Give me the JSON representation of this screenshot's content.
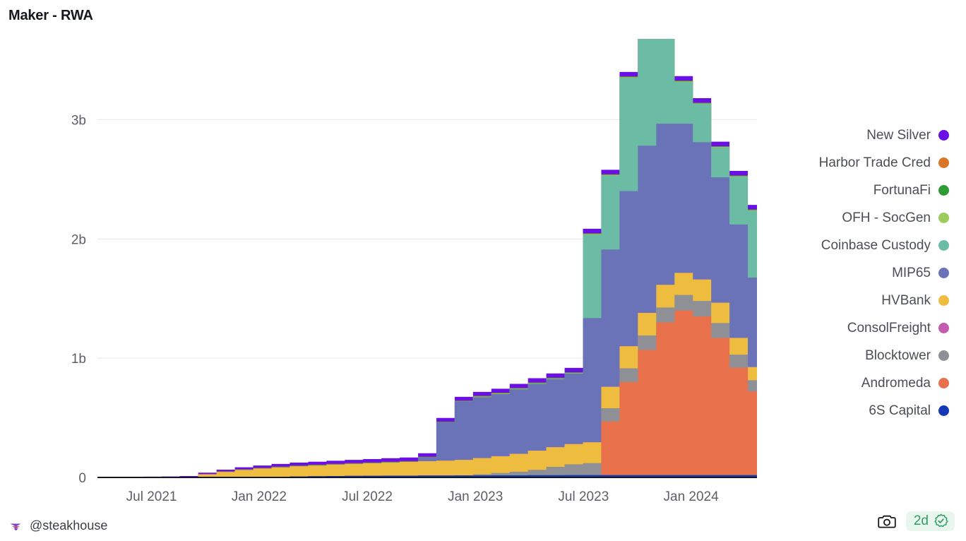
{
  "title": "Maker - RWA",
  "footer": {
    "handle": "@steakhouse",
    "logo_icon": "steakhouse-logo-icon",
    "camera_icon": "camera-icon",
    "freshness": "2d",
    "verified_icon": "verified-check-icon"
  },
  "legend": {
    "position": "right",
    "items": [
      {
        "label": "New Silver",
        "color": "#6a10e6"
      },
      {
        "label": "Harbor Trade Cred",
        "color": "#d97524"
      },
      {
        "label": "FortunaFi",
        "color": "#2e9b35"
      },
      {
        "label": "OFH - SocGen",
        "color": "#9ccb5e"
      },
      {
        "label": "Coinbase Custody",
        "color": "#6cbca5"
      },
      {
        "label": "MIP65",
        "color": "#6a72b8"
      },
      {
        "label": "HVBank",
        "color": "#eebc3f"
      },
      {
        "label": "ConsolFreight",
        "color": "#c45cb0"
      },
      {
        "label": "Blocktower",
        "color": "#8e9096"
      },
      {
        "label": "Andromeda",
        "color": "#e8714c"
      },
      {
        "label": "6S Capital",
        "color": "#1539b4"
      }
    ]
  },
  "chart_data": {
    "type": "area",
    "stacked": true,
    "title": "Maker - RWA",
    "xlabel": "",
    "ylabel": "",
    "grid": true,
    "ylim": [
      0,
      3500000000
    ],
    "yticks": [
      0,
      1000000000,
      2000000000,
      3000000000
    ],
    "ytick_labels": [
      "0",
      "1b",
      "2b",
      "3b"
    ],
    "xticks": [
      "Jul 2021",
      "Jan 2022",
      "Jul 2022",
      "Jan 2023",
      "Jul 2023",
      "Jan 2024"
    ],
    "xtick_positions": [
      0.082,
      0.245,
      0.409,
      0.573,
      0.737,
      0.9
    ],
    "x_range": [
      "2021-04",
      "2024-04"
    ],
    "x": [
      "2021-04",
      "2021-05",
      "2021-06",
      "2021-07",
      "2021-08",
      "2021-09",
      "2021-10",
      "2021-11",
      "2021-12",
      "2022-01",
      "2022-02",
      "2022-03",
      "2022-04",
      "2022-05",
      "2022-06",
      "2022-07",
      "2022-08",
      "2022-09",
      "2022-10",
      "2022-11",
      "2022-12",
      "2023-01",
      "2023-02",
      "2023-03",
      "2023-04",
      "2023-05",
      "2023-06",
      "2023-07",
      "2023-08",
      "2023-09",
      "2023-10",
      "2023-11",
      "2023-12",
      "2024-01",
      "2024-02",
      "2024-03",
      "2024-04"
    ],
    "series": [
      {
        "name": "6S Capital",
        "color": "#1539b4",
        "values": [
          0,
          0,
          0,
          0,
          0,
          0,
          0,
          1000000,
          2000000,
          4000000,
          6000000,
          8000000,
          10000000,
          12000000,
          13000000,
          14000000,
          15000000,
          15000000,
          16000000,
          16000000,
          17000000,
          17000000,
          18000000,
          18000000,
          19000000,
          19000000,
          20000000,
          20000000,
          20000000,
          20000000,
          20000000,
          20000000,
          20000000,
          20000000,
          20000000,
          20000000,
          20000000
        ]
      },
      {
        "name": "Andromeda",
        "color": "#e8714c",
        "values": [
          0,
          0,
          0,
          0,
          0,
          0,
          0,
          0,
          0,
          0,
          0,
          0,
          0,
          0,
          0,
          0,
          0,
          0,
          0,
          0,
          0,
          0,
          0,
          0,
          0,
          0,
          0,
          0,
          450000000,
          780000000,
          1050000000,
          1280000000,
          1380000000,
          1330000000,
          1150000000,
          900000000,
          700000000
        ]
      },
      {
        "name": "Blocktower",
        "color": "#8e9096",
        "values": [
          0,
          0,
          0,
          0,
          0,
          0,
          0,
          0,
          0,
          0,
          0,
          0,
          0,
          0,
          0,
          0,
          0,
          0,
          0,
          0,
          0,
          10000000,
          20000000,
          30000000,
          45000000,
          70000000,
          90000000,
          100000000,
          110000000,
          115000000,
          120000000,
          125000000,
          130000000,
          130000000,
          125000000,
          110000000,
          95000000
        ]
      },
      {
        "name": "HVBank",
        "color": "#eebc3f",
        "values": [
          0,
          0,
          0,
          0,
          0,
          2000000,
          25000000,
          45000000,
          60000000,
          70000000,
          78000000,
          85000000,
          90000000,
          95000000,
          100000000,
          105000000,
          110000000,
          115000000,
          120000000,
          125000000,
          130000000,
          135000000,
          140000000,
          150000000,
          160000000,
          165000000,
          170000000,
          175000000,
          180000000,
          185000000,
          190000000,
          190000000,
          185000000,
          180000000,
          170000000,
          140000000,
          110000000
        ]
      },
      {
        "name": "ConsolFreight",
        "color": "#c45cb0",
        "values": [
          1000000,
          1000000,
          1000000,
          1000000,
          1000000,
          1000000,
          1000000,
          1000000,
          1000000,
          1000000,
          1000000,
          1000000,
          1000000,
          1000000,
          1000000,
          1000000,
          1000000,
          1000000,
          1000000,
          1000000,
          1000000,
          1000000,
          1000000,
          1000000,
          1000000,
          1000000,
          1000000,
          1000000,
          1000000,
          1000000,
          1000000,
          1000000,
          1000000,
          1000000,
          1000000,
          1000000,
          1000000
        ]
      },
      {
        "name": "MIP65",
        "color": "#6a72b8",
        "values": [
          0,
          0,
          0,
          0,
          0,
          0,
          0,
          0,
          0,
          0,
          0,
          0,
          0,
          0,
          0,
          0,
          0,
          0,
          30000000,
          320000000,
          490000000,
          510000000,
          520000000,
          540000000,
          560000000,
          570000000,
          590000000,
          1040000000,
          1150000000,
          1300000000,
          1400000000,
          1350000000,
          1250000000,
          1150000000,
          1050000000,
          950000000,
          750000000
        ]
      },
      {
        "name": "Coinbase Custody",
        "color": "#6cbca5",
        "values": [
          0,
          0,
          0,
          0,
          0,
          0,
          0,
          0,
          0,
          0,
          0,
          0,
          0,
          0,
          0,
          0,
          0,
          0,
          0,
          0,
          0,
          0,
          0,
          0,
          0,
          0,
          0,
          700000000,
          620000000,
          950000000,
          1450000000,
          760000000,
          350000000,
          320000000,
          250000000,
          400000000,
          560000000
        ]
      },
      {
        "name": "OFH - SocGen",
        "color": "#9ccb5e",
        "values": [
          0,
          0,
          0,
          0,
          0,
          0,
          0,
          0,
          0,
          0,
          0,
          0,
          0,
          0,
          0,
          0,
          0,
          0,
          0,
          0,
          0,
          5000000,
          5000000,
          5000000,
          5000000,
          5000000,
          5000000,
          5000000,
          5000000,
          5000000,
          5000000,
          5000000,
          5000000,
          5000000,
          5000000,
          5000000,
          5000000
        ]
      },
      {
        "name": "FortunaFi",
        "color": "#2e9b35",
        "values": [
          0,
          0,
          0,
          0,
          0,
          0,
          1000000,
          2000000,
          3000000,
          3000000,
          4000000,
          4000000,
          4000000,
          4000000,
          4000000,
          4000000,
          4000000,
          4000000,
          4000000,
          4000000,
          4000000,
          4000000,
          4000000,
          4000000,
          4000000,
          4000000,
          4000000,
          4000000,
          4000000,
          4000000,
          4000000,
          4000000,
          4000000,
          4000000,
          4000000,
          4000000,
          4000000
        ]
      },
      {
        "name": "Harbor Trade Cred",
        "color": "#d97524",
        "values": [
          1000000,
          1000000,
          1000000,
          1000000,
          1000000,
          1000000,
          2000000,
          2000000,
          2000000,
          2000000,
          2000000,
          2000000,
          2000000,
          2000000,
          2000000,
          2000000,
          2000000,
          2000000,
          2000000,
          2000000,
          2000000,
          2000000,
          2000000,
          2000000,
          2000000,
          2000000,
          2000000,
          2000000,
          2000000,
          2000000,
          2000000,
          2000000,
          2000000,
          2000000,
          2000000,
          2000000,
          2000000
        ]
      },
      {
        "name": "New Silver",
        "color": "#6a10e6",
        "values": [
          2000000,
          3000000,
          4000000,
          5000000,
          6000000,
          8000000,
          11000000,
          14000000,
          17000000,
          20000000,
          22000000,
          24000000,
          25000000,
          26000000,
          27000000,
          28000000,
          29000000,
          30000000,
          30000000,
          31000000,
          32000000,
          33000000,
          34000000,
          35000000,
          36000000,
          36000000,
          37000000,
          38000000,
          38000000,
          38000000,
          38000000,
          38000000,
          38000000,
          38000000,
          38000000,
          38000000,
          38000000
        ]
      }
    ]
  }
}
